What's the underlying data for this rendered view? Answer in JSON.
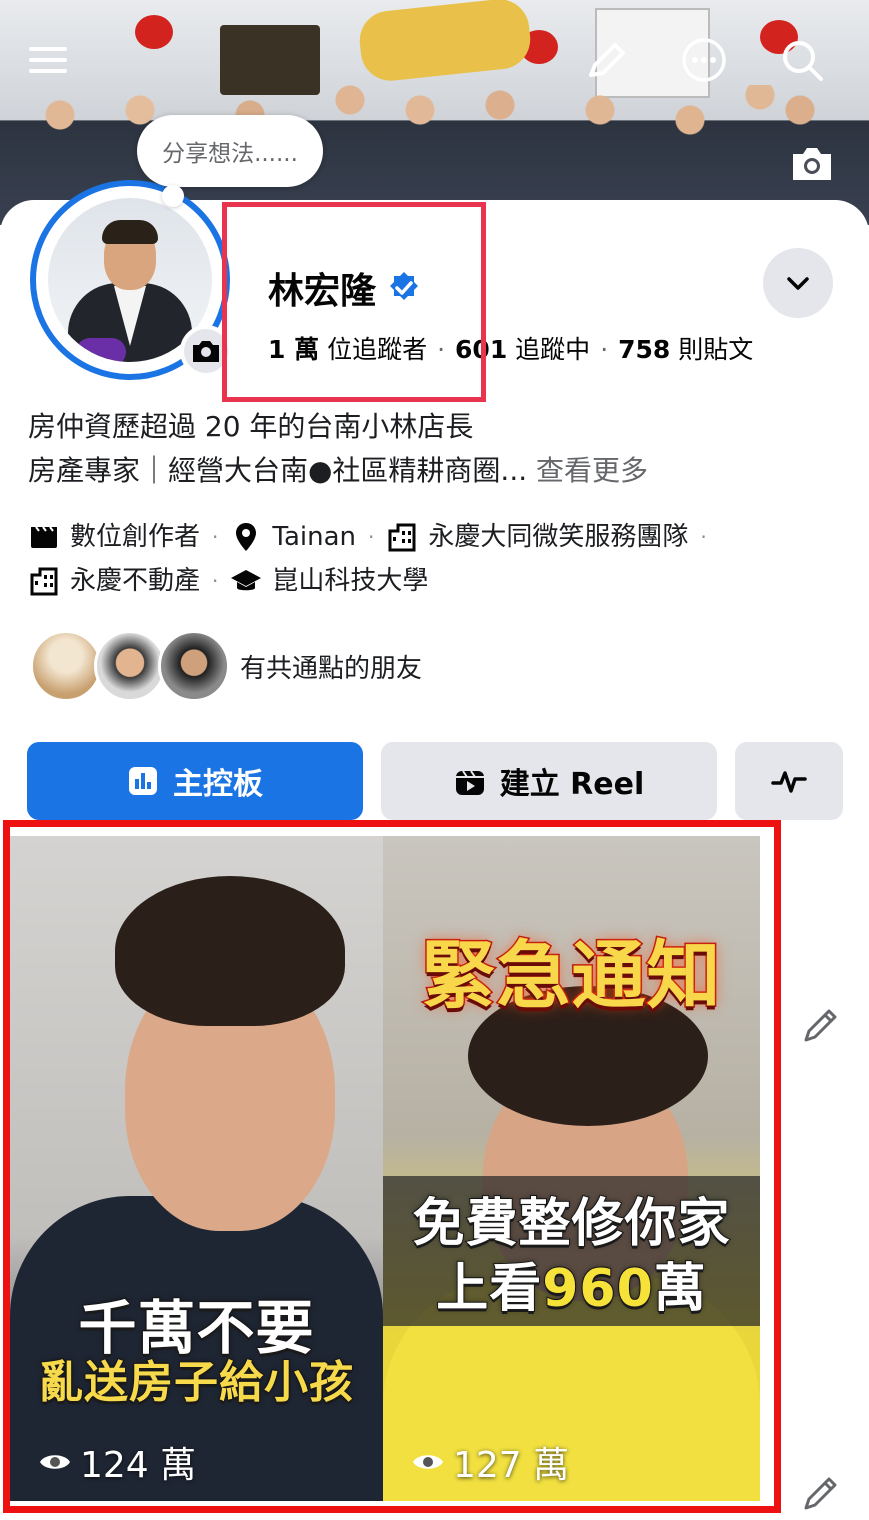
{
  "cover": {
    "icons": [
      "menu-icon",
      "edit-pencil-icon",
      "more-dots-icon",
      "search-icon",
      "camera-icon"
    ]
  },
  "composer": {
    "bubble_text": "分享想法......"
  },
  "profile": {
    "name": "林宏隆",
    "verified": true,
    "followers_count": "1 萬",
    "followers_label": "位追蹤者",
    "following_count": "601",
    "following_label": "追蹤中",
    "posts_count": "758",
    "posts_label": "則貼文",
    "bio_line1": "房仲資歷超過 20 年的台南小林店長",
    "bio_line2": "房產專家｜經營大台南●社區精耕商圈...",
    "see_more": "查看更多"
  },
  "details": {
    "row1": [
      {
        "icon": "clapperboard-icon",
        "text": "數位創作者"
      },
      {
        "icon": "location-pin-icon",
        "text": "Tainan"
      },
      {
        "icon": "building-icon",
        "text": "永慶大同微笑服務團隊"
      }
    ],
    "row2": [
      {
        "icon": "building-icon",
        "text": "永慶不動產"
      },
      {
        "icon": "graduation-cap-icon",
        "text": "崑山科技大學"
      }
    ]
  },
  "mutual": {
    "label": "有共通點的朋友"
  },
  "actions": {
    "dashboard_label": "主控板",
    "create_reel_label": "建立 Reel"
  },
  "reels": [
    {
      "caption_line1": "千萬不要",
      "caption_line2": "亂送房子給小孩",
      "views": "124 萬"
    },
    {
      "caption_top": "緊急通知",
      "caption_line1": "免費整修你家",
      "caption_line2_prefix": "上看",
      "caption_line2_highlight": "960",
      "caption_line2_suffix": "萬",
      "views": "127 萬"
    }
  ],
  "colors": {
    "primary_blue": "#1b74e4",
    "highlight_red": "#e8344e",
    "reels_border_red": "#ee1111",
    "secondary_gray": "#e4e6eb"
  }
}
